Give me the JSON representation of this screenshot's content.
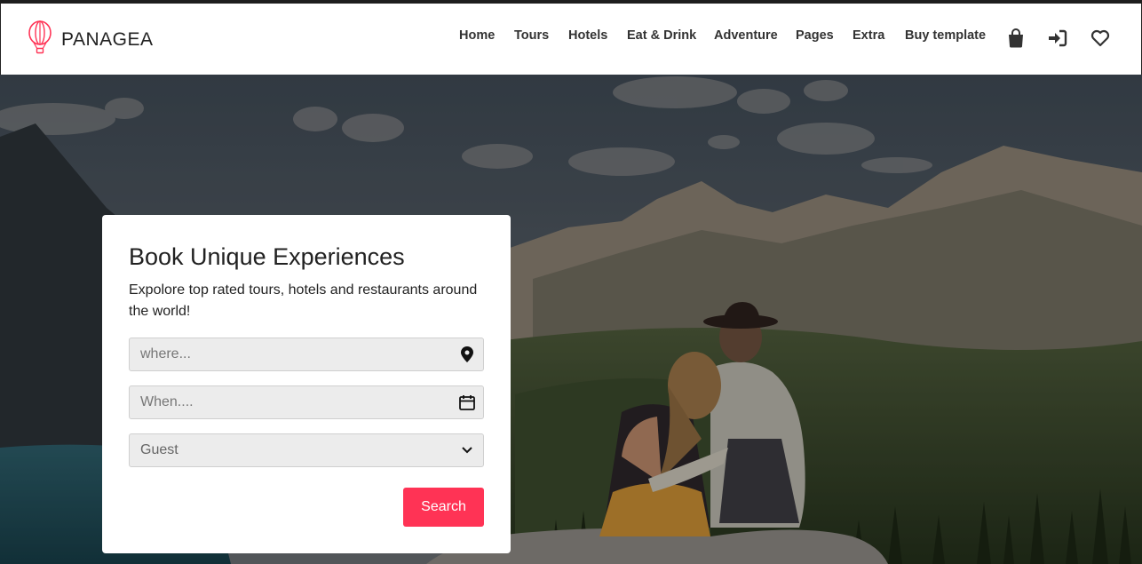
{
  "brand": {
    "name": "PANAGEA",
    "logo_icon": "hot-air-balloon-icon",
    "accent": "#ff3355"
  },
  "nav": {
    "items": [
      {
        "label": "Home"
      },
      {
        "label": "Tours"
      },
      {
        "label": "Hotels"
      },
      {
        "label": "Eat & Drink"
      },
      {
        "label": "Adventure"
      },
      {
        "label": "Pages"
      },
      {
        "label": "Extra"
      },
      {
        "label": "Buy template"
      }
    ],
    "icons": [
      "shopping-bag-icon",
      "sign-in-icon",
      "heart-icon"
    ]
  },
  "hero": {
    "image": "couple-overlooking-mountain-valley"
  },
  "booking": {
    "title": "Book Unique Experiences",
    "subtitle": "Expolore top rated tours, hotels and restaurants around the world!",
    "where_placeholder": "where...",
    "when_placeholder": "When....",
    "guest_value": "Guest",
    "search_label": "Search",
    "icons": [
      "map-pin-icon",
      "calendar-icon",
      "chevron-down-icon"
    ]
  }
}
